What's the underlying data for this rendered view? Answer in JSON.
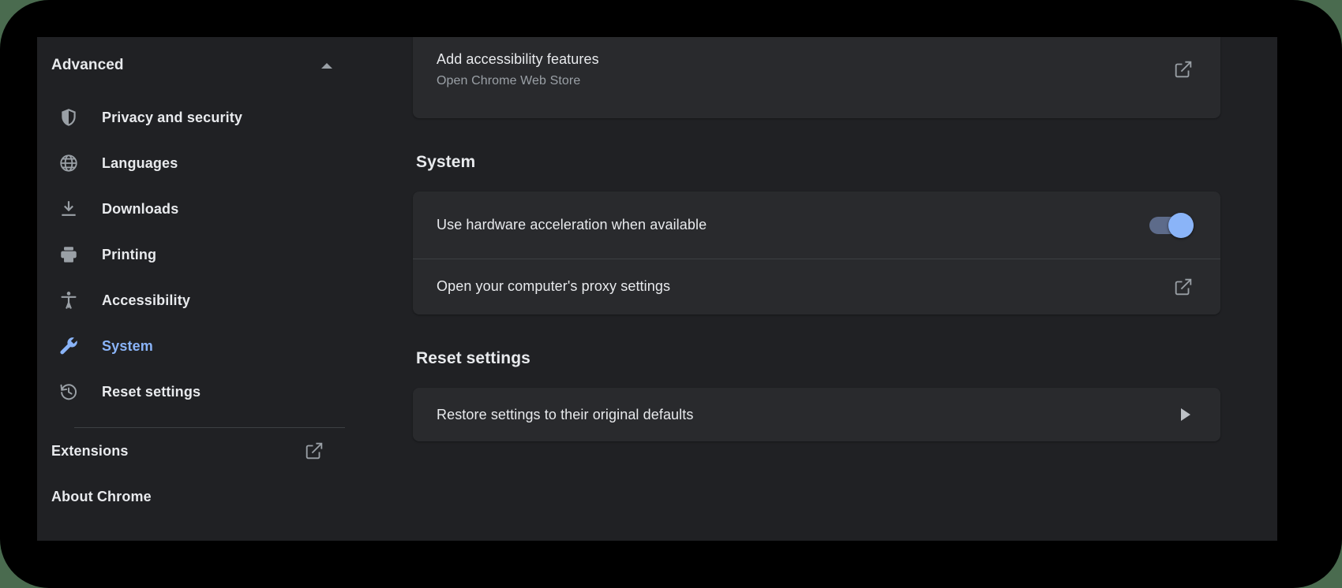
{
  "window": {
    "background": "#202124",
    "card_background": "#292a2d",
    "accent": "#8ab4f8",
    "text_primary": "#e8eaed",
    "text_secondary": "#9aa0a6",
    "frame_background": "#000000",
    "page_background": "#4a6b4f"
  },
  "sidebar": {
    "header": {
      "label": "Advanced",
      "expanded": true,
      "caret": "caret-up-icon"
    },
    "items": [
      {
        "label": "Privacy and security",
        "icon": "shield-icon",
        "selected": false
      },
      {
        "label": "Languages",
        "icon": "globe-icon",
        "selected": false
      },
      {
        "label": "Downloads",
        "icon": "download-icon",
        "selected": false
      },
      {
        "label": "Printing",
        "icon": "printer-icon",
        "selected": false
      },
      {
        "label": "Accessibility",
        "icon": "accessibility-icon",
        "selected": false
      },
      {
        "label": "System",
        "icon": "wrench-icon",
        "selected": true
      },
      {
        "label": "Reset settings",
        "icon": "history-restore-icon",
        "selected": false
      }
    ],
    "footer": [
      {
        "label": "Extensions",
        "icon": "external-link-icon",
        "has_external_link": true
      },
      {
        "label": "About Chrome",
        "icon": "",
        "has_external_link": false
      }
    ]
  },
  "main": {
    "accessibility_card": {
      "row": {
        "title": "Add accessibility features",
        "subtitle": "Open Chrome Web Store",
        "action_icon": "external-link-icon"
      }
    },
    "system_section": {
      "heading": "System",
      "rows": [
        {
          "title": "Use hardware acceleration when available",
          "control": "toggle",
          "toggle_on": true
        },
        {
          "title": "Open your computer's proxy settings",
          "control": "external-link-icon"
        }
      ]
    },
    "reset_section": {
      "heading": "Reset settings",
      "rows": [
        {
          "title": "Restore settings to their original defaults",
          "control": "chevron-right-icon"
        }
      ]
    }
  }
}
